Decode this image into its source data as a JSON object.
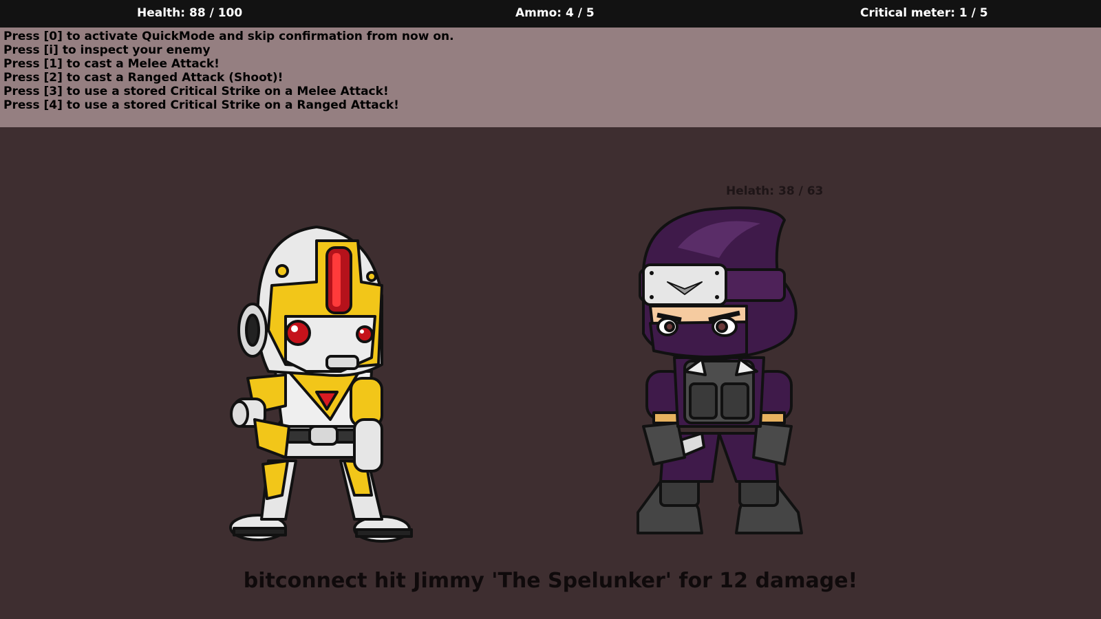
{
  "hud": {
    "health": "Health: 88 / 100",
    "ammo": "Ammo: 4 / 5",
    "critical": "Critical meter: 1 / 5"
  },
  "instructions": [
    "Press [0] to activate QuickMode and skip confirmation from now on.",
    "Press [i] to inspect your enemy",
    "Press [1] to cast a Melee Attack!",
    "Press [2] to cast a Ranged Attack (Shoot)!",
    "Press [3] to use a stored Critical Strike on a Melee Attack!",
    "Press [4] to use a stored Critical Strike on a Ranged Attack!"
  ],
  "enemy": {
    "health_label": "Helath: 38 / 63"
  },
  "battle_log": "bitconnect hit Jimmy 'The Spelunker' for 12 damage!",
  "colors": {
    "background": "#3e2e30",
    "instructions_panel": "#957f81",
    "top_bar": "#121212",
    "robot_gold": "#f2c619",
    "ninja_purple": "#3f1a4a"
  }
}
